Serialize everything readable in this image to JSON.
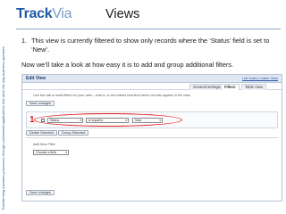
{
  "side_tagline": "Transforming business processes through customized applications that work the way business operates.",
  "logo": {
    "part1": "Track",
    "part2": "Via"
  },
  "slide_title": "Views",
  "bullet": {
    "number": "1.",
    "text": "This view is currently filtered to show only records where the ‘Status’ field is set to ‘New’."
  },
  "note": "Now we’ll take a look at how easy it is to add and group additional filters.",
  "shot": {
    "title": "Edit View",
    "links": "List Index | Index View",
    "tabs": [
      {
        "label": "General settings"
      },
      {
        "label": "Filters"
      },
      {
        "label": "Table View"
      }
    ],
    "hint": "Use this tab to build filters for your view – that is, to set criteria that limit which records appear in the view.",
    "save_top": "Save changes",
    "filter": {
      "number": "1",
      "field": "Status",
      "operator": "is equal to",
      "value": "New"
    },
    "delete_selected": "Delete Selected",
    "group_selected": "Group Selected",
    "add_new_filter": "Add New Filter",
    "choose_field": "Choose a field",
    "save_bottom": "Save changes"
  },
  "colors": {
    "brand": "#1e5aa3",
    "highlight": "#e01a1a"
  }
}
